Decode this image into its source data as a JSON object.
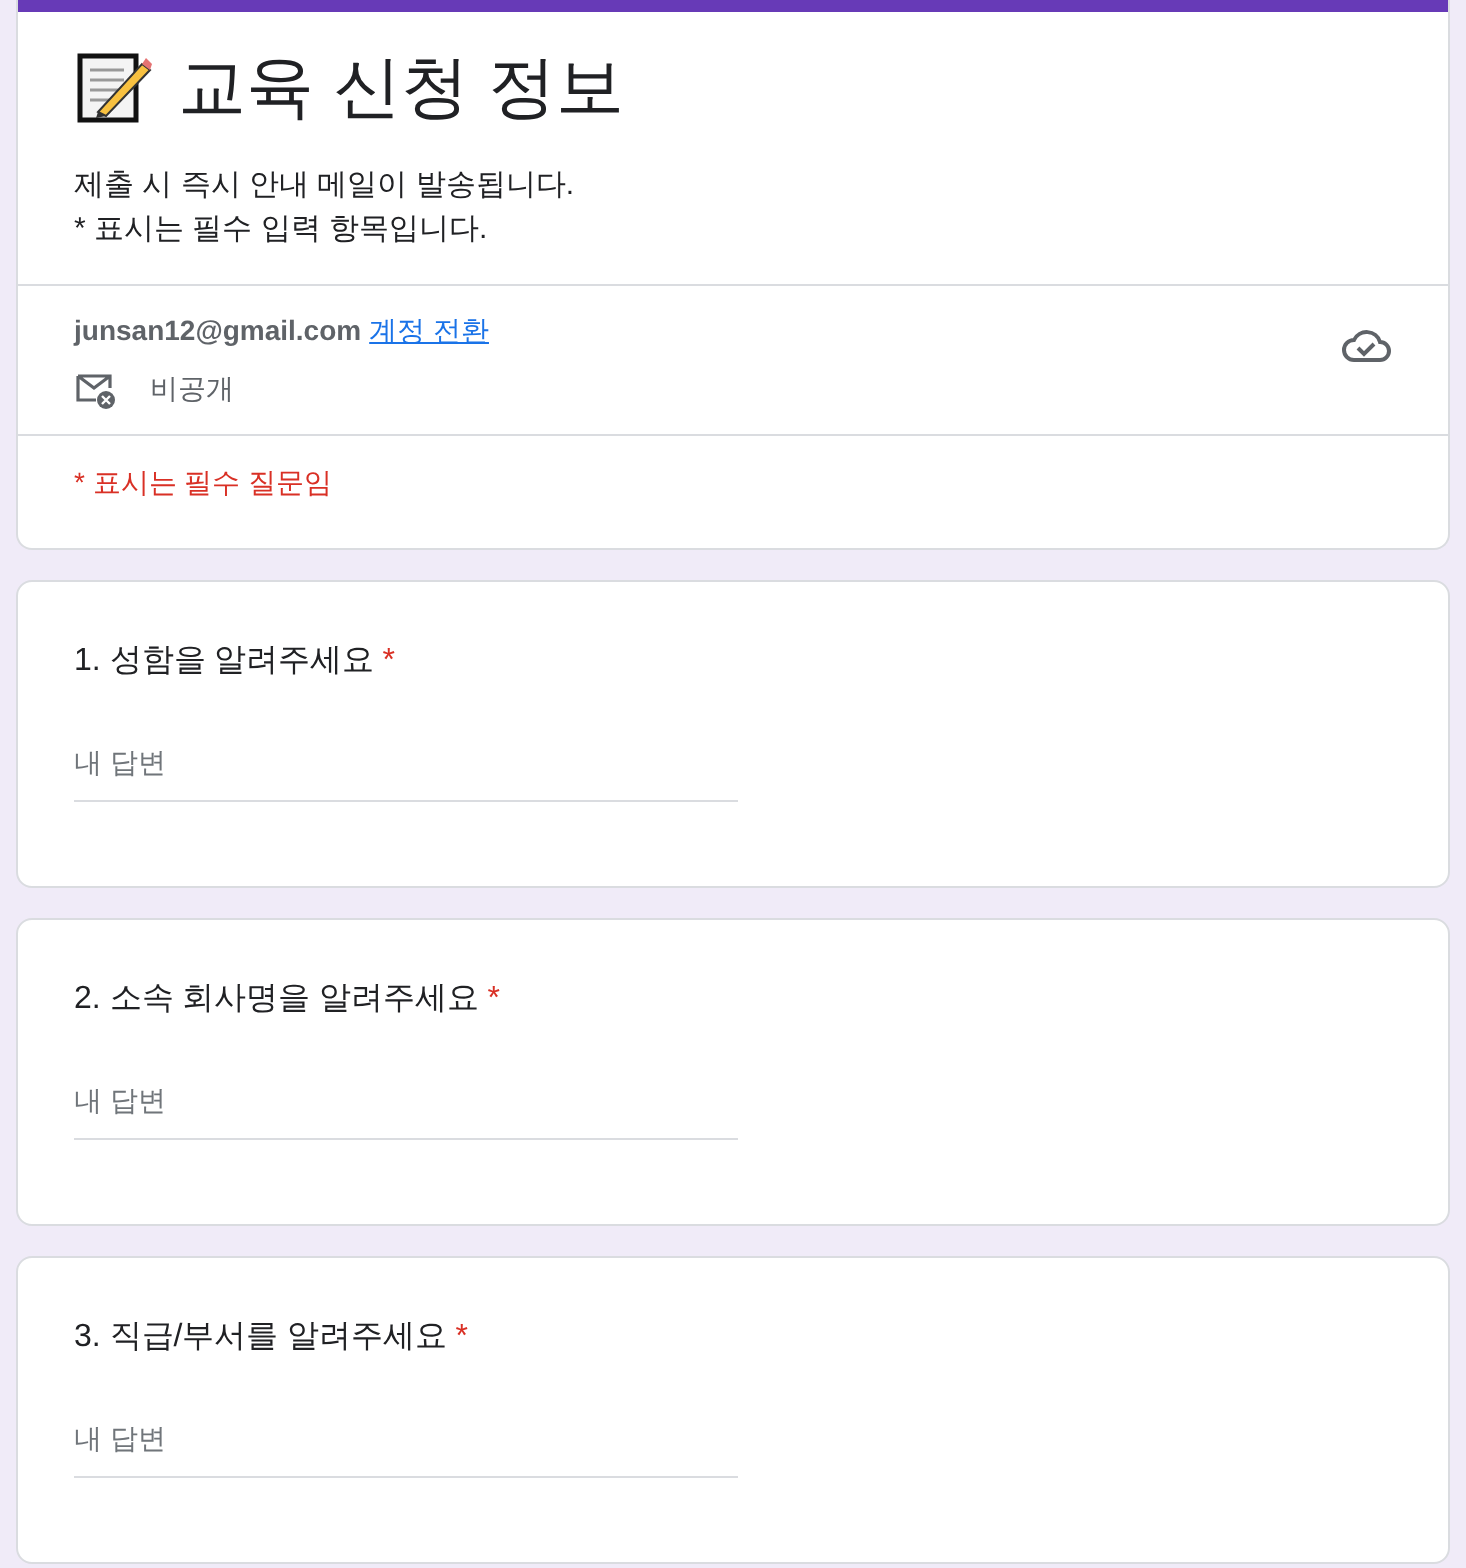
{
  "header": {
    "title": "교육 신청 정보",
    "description": [
      "제출 시 즉시 안내 메일이 발송됩니다.",
      "* 표시는 필수 입력 항목입니다."
    ]
  },
  "account": {
    "email": "junsan12@gmail.com",
    "switch_link": "계정 전환",
    "privacy": "비공개"
  },
  "required_note": "* 표시는 필수 질문임",
  "questions": [
    {
      "title": "1. 성함을 알려주세요",
      "required_mark": "*",
      "placeholder": "내 답변"
    },
    {
      "title": "2. 소속 회사명을 알려주세요",
      "required_mark": "*",
      "placeholder": "내 답변"
    },
    {
      "title": "3. 직급/부서를 알려주세요",
      "required_mark": "*",
      "placeholder": "내 답변"
    }
  ]
}
